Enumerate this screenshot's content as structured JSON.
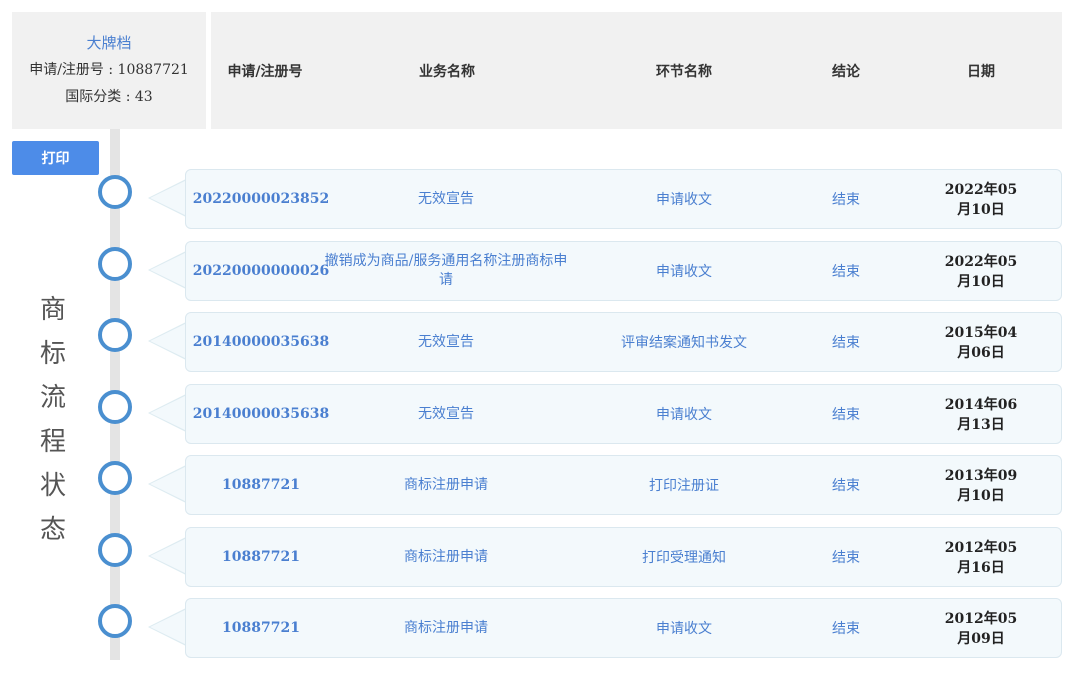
{
  "header": {
    "brand": "大牌档",
    "reg_no_label": "申请/注册号 : 10887721",
    "class_label": "国际分类 : 43",
    "columns": {
      "reg_no": "申请/注册号",
      "business": "业务名称",
      "stage": "环节名称",
      "result": "结论",
      "date": "日期"
    }
  },
  "print_button": "打印",
  "side_title": "商\n标\n流\n程\n状\n态",
  "rows": [
    {
      "reg_no": "20220000023852",
      "business": "无效宣告",
      "stage": "申请收文",
      "result": "结束",
      "date": "2022年05月10日"
    },
    {
      "reg_no": "20220000000026",
      "business": "撤销成为商品/服务通用名称注册商标申请",
      "stage": "申请收文",
      "result": "结束",
      "date": "2022年05月10日"
    },
    {
      "reg_no": "20140000035638",
      "business": "无效宣告",
      "stage": "评审结案通知书发文",
      "result": "结束",
      "date": "2015年04月06日"
    },
    {
      "reg_no": "20140000035638",
      "business": "无效宣告",
      "stage": "申请收文",
      "result": "结束",
      "date": "2014年06月13日"
    },
    {
      "reg_no": "10887721",
      "business": "商标注册申请",
      "stage": "打印注册证",
      "result": "结束",
      "date": "2013年09月10日"
    },
    {
      "reg_no": "10887721",
      "business": "商标注册申请",
      "stage": "打印受理通知",
      "result": "结束",
      "date": "2012年05月16日"
    },
    {
      "reg_no": "10887721",
      "business": "商标注册申请",
      "stage": "申请收文",
      "result": "结束",
      "date": "2012年05月09日"
    }
  ],
  "colors": {
    "accent": "#4a7fd0",
    "button": "#4d8ce8",
    "card_bg": "#f3f9fc",
    "header_bg": "#f1f1f1"
  }
}
